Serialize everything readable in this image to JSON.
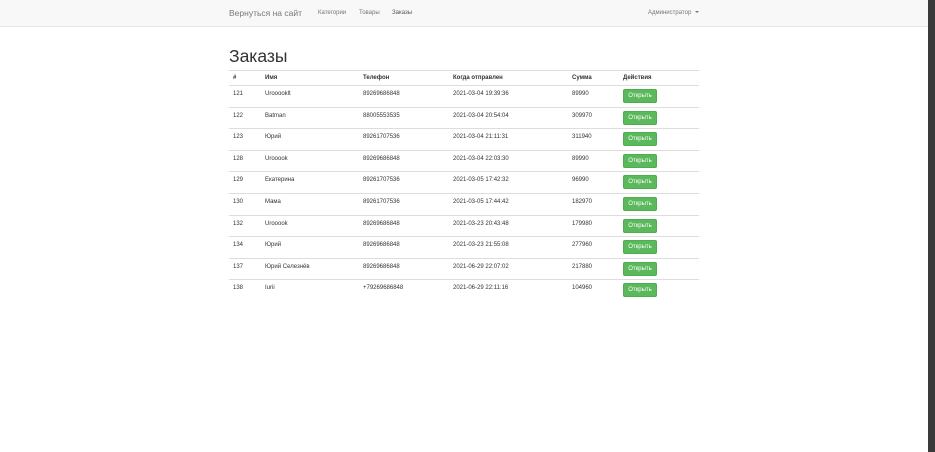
{
  "navbar": {
    "brand": "Вернуться на сайт",
    "links": [
      "Категории",
      "Товары",
      "Заказы"
    ],
    "admin_label": "Администратор"
  },
  "page": {
    "title": "Заказы"
  },
  "table": {
    "headers": {
      "id": "#",
      "name": "Имя",
      "phone": "Телефон",
      "date": "Когда отправлен",
      "sum": "Сумма",
      "actions": "Действия"
    },
    "rows": [
      {
        "id": "121",
        "name": "Urooooklt",
        "phone": "89269686848",
        "date": "2021-03-04 19:39:36",
        "sum": "89990",
        "action": "Открыть"
      },
      {
        "id": "122",
        "name": "Batman",
        "phone": "88005553535",
        "date": "2021-03-04 20:54:04",
        "sum": "309970",
        "action": "Открыть"
      },
      {
        "id": "123",
        "name": "Юрий",
        "phone": "89261707536",
        "date": "2021-03-04 21:11:31",
        "sum": "311940",
        "action": "Открыть"
      },
      {
        "id": "128",
        "name": "Urooook",
        "phone": "89269686848",
        "date": "2021-03-04 22:03:30",
        "sum": "89990",
        "action": "Открыть"
      },
      {
        "id": "129",
        "name": "Екатерина",
        "phone": "89261707536",
        "date": "2021-03-05 17:42:32",
        "sum": "96990",
        "action": "Открыть"
      },
      {
        "id": "130",
        "name": "Мама",
        "phone": "89261707536",
        "date": "2021-03-05 17:44:42",
        "sum": "182970",
        "action": "Открыть"
      },
      {
        "id": "132",
        "name": "Urooook",
        "phone": "89269686848",
        "date": "2021-03-23 20:43:48",
        "sum": "179980",
        "action": "Открыть"
      },
      {
        "id": "134",
        "name": "Юрий",
        "phone": "89269686848",
        "date": "2021-03-23 21:55:08",
        "sum": "277960",
        "action": "Открыть"
      },
      {
        "id": "137",
        "name": "Юрий Селезнёв",
        "phone": "89269686848",
        "date": "2021-06-29 22:07:02",
        "sum": "217880",
        "action": "Открыть"
      },
      {
        "id": "138",
        "name": "Iurii",
        "phone": "+79269686848",
        "date": "2021-06-29 22:11:16",
        "sum": "104960",
        "action": "Открыть"
      }
    ]
  },
  "colors": {
    "button": "#5cb85c",
    "navbar_bg": "#f8f8f8",
    "scrollbar": "#3a3a3a"
  }
}
